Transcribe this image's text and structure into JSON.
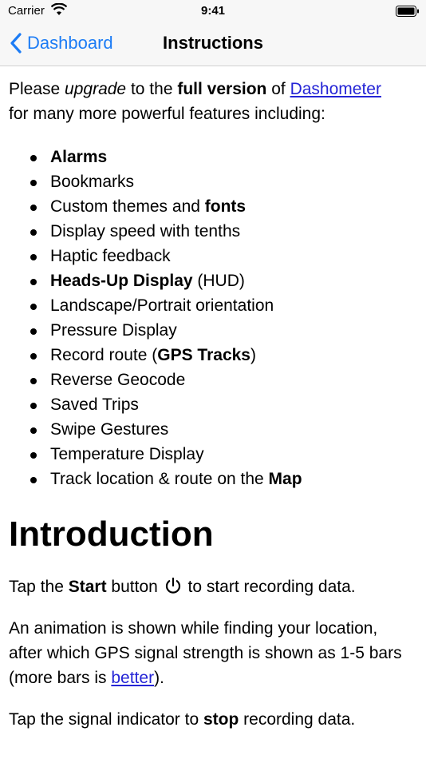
{
  "status": {
    "carrier": "Carrier",
    "time": "9:41"
  },
  "nav": {
    "back_label": "Dashboard",
    "title": "Instructions"
  },
  "intro": {
    "please": "Please ",
    "upgrade": "upgrade",
    "to_the": " to the ",
    "full_version": "full version",
    "of": " of ",
    "app_link": "Dashometer",
    "for_many": "for many more powerful features including:"
  },
  "features": [
    {
      "parts": [
        {
          "t": "Alarms",
          "b": true
        }
      ]
    },
    {
      "parts": [
        {
          "t": "Bookmarks",
          "b": false
        }
      ]
    },
    {
      "parts": [
        {
          "t": "Custom themes and ",
          "b": false
        },
        {
          "t": "fonts",
          "b": true
        }
      ]
    },
    {
      "parts": [
        {
          "t": "Display speed with tenths",
          "b": false
        }
      ]
    },
    {
      "parts": [
        {
          "t": "Haptic feedback",
          "b": false
        }
      ]
    },
    {
      "parts": [
        {
          "t": "Heads-Up Display",
          "b": true
        },
        {
          "t": " (HUD)",
          "b": false
        }
      ]
    },
    {
      "parts": [
        {
          "t": "Landscape/Portrait orientation",
          "b": false
        }
      ]
    },
    {
      "parts": [
        {
          "t": "Pressure Display",
          "b": false
        }
      ]
    },
    {
      "parts": [
        {
          "t": "Record route (",
          "b": false
        },
        {
          "t": "GPS Tracks",
          "b": true
        },
        {
          "t": ")",
          "b": false
        }
      ]
    },
    {
      "parts": [
        {
          "t": "Reverse Geocode",
          "b": false
        }
      ]
    },
    {
      "parts": [
        {
          "t": "Saved Trips",
          "b": false
        }
      ]
    },
    {
      "parts": [
        {
          "t": "Swipe Gestures",
          "b": false
        }
      ]
    },
    {
      "parts": [
        {
          "t": "Temperature Display",
          "b": false
        }
      ]
    },
    {
      "parts": [
        {
          "t": "Track location & route on the ",
          "b": false
        },
        {
          "t": "Map",
          "b": true
        }
      ]
    }
  ],
  "introduction": {
    "heading": "Introduction",
    "p1_tap": "Tap the ",
    "p1_start": "Start",
    "p1_button": " button ",
    "p1_rest": " to start recording data.",
    "p2_text": "An animation is shown while finding your location, after which GPS signal strength is shown as 1-5 bars (more bars is ",
    "p2_link": "better",
    "p2_end": ").",
    "p3_tap": "Tap the signal indicator to ",
    "p3_stop": "stop",
    "p3_rest": " recording data."
  },
  "icons": {
    "wifi": "wifi-icon",
    "battery": "battery-icon",
    "back": "chevron-left-icon",
    "power": "power-icon"
  },
  "colors": {
    "accent": "#1c7cf5",
    "link": "#2424d6",
    "bar_background": "#f7f7f7"
  }
}
